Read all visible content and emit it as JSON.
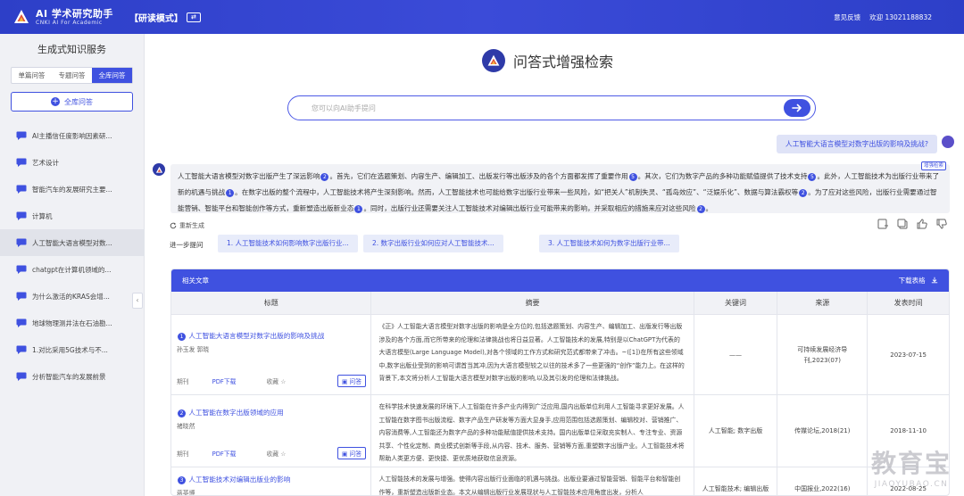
{
  "app": {
    "title": "AI 学术研究助手",
    "subtitle": "CNKI AI For Academic",
    "mode_label": "【研读模式】",
    "feedback": "意见反馈",
    "welcome": "欢迎 13021188832",
    "brand_color": "#3f51e0"
  },
  "sidebar": {
    "title": "生成式知识服务",
    "tabs": [
      "单篇问答",
      "专题问答",
      "全库问答"
    ],
    "active_tab": "全库问答",
    "add_button": "全库问答",
    "items": [
      "AI主播信任度影响因素研...",
      "艺术设计",
      "智能汽车的发展研究主要...",
      "计算机",
      "人工智能大语言模型对数...",
      "chatgpt在计算机领域的...",
      "为什么激活的KRAS会增...",
      "地球物理测井法在石油勘...",
      "1.对比采用5G技术与不...",
      "分析智能汽车的发展前景"
    ]
  },
  "main": {
    "hero_title": "问答式增强检索",
    "search_placeholder": "您可以向AI助手提问",
    "question": "人工智能大语言模型对数字出版的影响及挑战?",
    "answer_badge": "增强检索",
    "answer": [
      {
        "t": "人工智能大语言模型对数字出版产生了深远影响"
      },
      {
        "c": "2"
      },
      {
        "t": "。首先，它们在选题策划、内容生产、编辑加工、出版发行等出版涉及的各个方面都发挥了重要作用"
      },
      {
        "c": "5"
      },
      {
        "t": "。其次，它们为数字产品的多种功能赋值提供了技术支持"
      },
      {
        "c": "5"
      },
      {
        "t": "。此外，人工智能技术为出版行业带来了新的机遇与挑战"
      },
      {
        "c": "1"
      },
      {
        "t": "。在数字出版的整个流程中，人工智能技术将产生深刻影响。然而，人工智能技术也可能给数字出版行业带来一些风险，如“把关人”机制失灵、“孤岛效应”、“泛娱乐化”、数据与算法霸权等"
      },
      {
        "c": "2"
      },
      {
        "t": "。为了应对这些风险，出版行业需要通过智能营销、智能平台和智能创作等方式，重新塑造出版新业态"
      },
      {
        "c": "1"
      },
      {
        "t": "。同时，出版行业还需要关注人工智能技术对编辑出版行业可能带来的影响，并采取相应的措施来应对这些风险"
      },
      {
        "c": "2"
      },
      {
        "t": "。"
      }
    ],
    "regenerate": "重新生成",
    "followup_label": "进一步提问",
    "followups": [
      "1. 人工智能技术如何影响数字出版行业...",
      "2. 数字出版行业如何应对人工智能技术...",
      "3. 人工智能技术如何为数字出版行业带..."
    ]
  },
  "articles": {
    "header": "相关文章",
    "download": "下载表格",
    "columns": [
      "标题",
      "摘要",
      "关键词",
      "来源",
      "发表时间"
    ],
    "rows": [
      {
        "num": "1",
        "title": "人工智能大语言模型对数字出版的影响及挑战",
        "author": "孙玉发 郭晓",
        "type": "期刊",
        "pdf": "PDF下载",
        "fav": "收藏",
        "ask": "问答",
        "abstract": "《正》人工智能大语言模型对数字出版的影响是全方位的,包括选题策划、内容生产、编辑加工、出版发行等出版涉及的各个方面,而它所带来的伦理和法律挑战也将日益显著。人工智能技术的发展,特别是以ChatGPT为代表的大语言模型(Large Language Model),对各个领域的工作方式和研究范式都带来了冲击。~([1])在所有这些领域中,数字出版业受到的影响可谓首当其冲,因为大语言模型较之以往的技术多了一些更强的“创作”能力上。在这样的背景下,本文将分析人工智能大语言模型对数字出版的影响,以及其引发的伦理和法律挑战。",
        "keywords": "——",
        "source": "可持续发展经济导刊,2023(07)",
        "date": "2023-07-15"
      },
      {
        "num": "2",
        "title": "人工智能在数字出版领域的应用",
        "author": "褚晓然",
        "type": "期刊",
        "pdf": "PDF下载",
        "fav": "收藏",
        "ask": "问答",
        "abstract": "在科学技术快速发展的环境下,人工智能在许多产业内得到广泛应用,国内出版单位利用人工智能寻求更好发展。人工智能在数字图书出版流程、数字产品生产研发等方面大显身手,应用范围包括选题策划、编辑校对、营销推广、内容消费等,人工智能还为数字产品的多种功能赋值提供技术支持。国内出版单位采取充实制人、专注专业、资源共享、个性化定制、商业模式创新等手段,从内容、技术、服务、营销等方面,重塑数字出版产业。人工智能技术将帮助人类更方便、更快捷、更优质地获取信息资源。",
        "keywords": "人工智能; 数字出版",
        "source": "传媒论坛,2018(21)",
        "date": "2018-11-10"
      },
      {
        "num": "3",
        "title": "人工智能技术对编辑出版业的影响",
        "author": "蒋英博",
        "abstract": "人工智能技术的发展与增强。使得内容出版行业面临的机遇与挑战。出版业要通过智能营销、智能平台和智能创作等，重新塑造出版新业态。本文从编辑出版行业发展现状与人工智能技术应用角度出发，分析人",
        "keywords": "人工智能技术; 编辑出版",
        "source": "中国报业,2022(16)",
        "date": "2022-08-25"
      }
    ]
  },
  "watermark": {
    "big": "教育宝",
    "small": "JIAOYUBAO.CN"
  }
}
